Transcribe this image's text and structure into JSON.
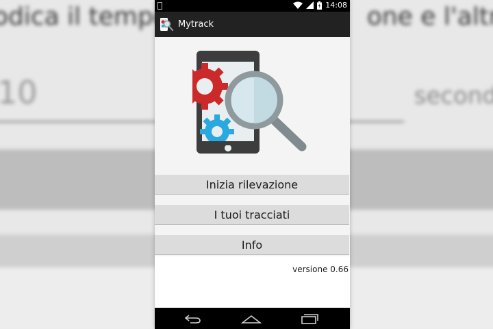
{
  "background": {
    "blurred_heading": "odica il tempo",
    "blurred_heading_right": "one e l'altra",
    "blurred_number": "10",
    "blurred_unit": "second"
  },
  "status_bar": {
    "time": "14:08",
    "icons": [
      "notification-icon",
      "wifi-icon",
      "signal-icon",
      "battery-icon"
    ]
  },
  "action_bar": {
    "app_icon": "mytrack-app-icon",
    "title": "Mytrack"
  },
  "illustration": {
    "icon": "phone-gears-magnifier-illustration",
    "colors": {
      "phone": "#3d3d3d",
      "gear_red": "#cc2a2a",
      "gear_blue": "#2aa8e0",
      "magnifier": "#7f8b8f",
      "lens": "#d6e8ee"
    }
  },
  "buttons": {
    "start": "Inizia rilevazione",
    "tracks": "I tuoi tracciati",
    "info": "Info"
  },
  "version": "versione 0.66",
  "nav_bar": {
    "icons": [
      "back-icon",
      "home-icon",
      "recents-icon"
    ]
  }
}
